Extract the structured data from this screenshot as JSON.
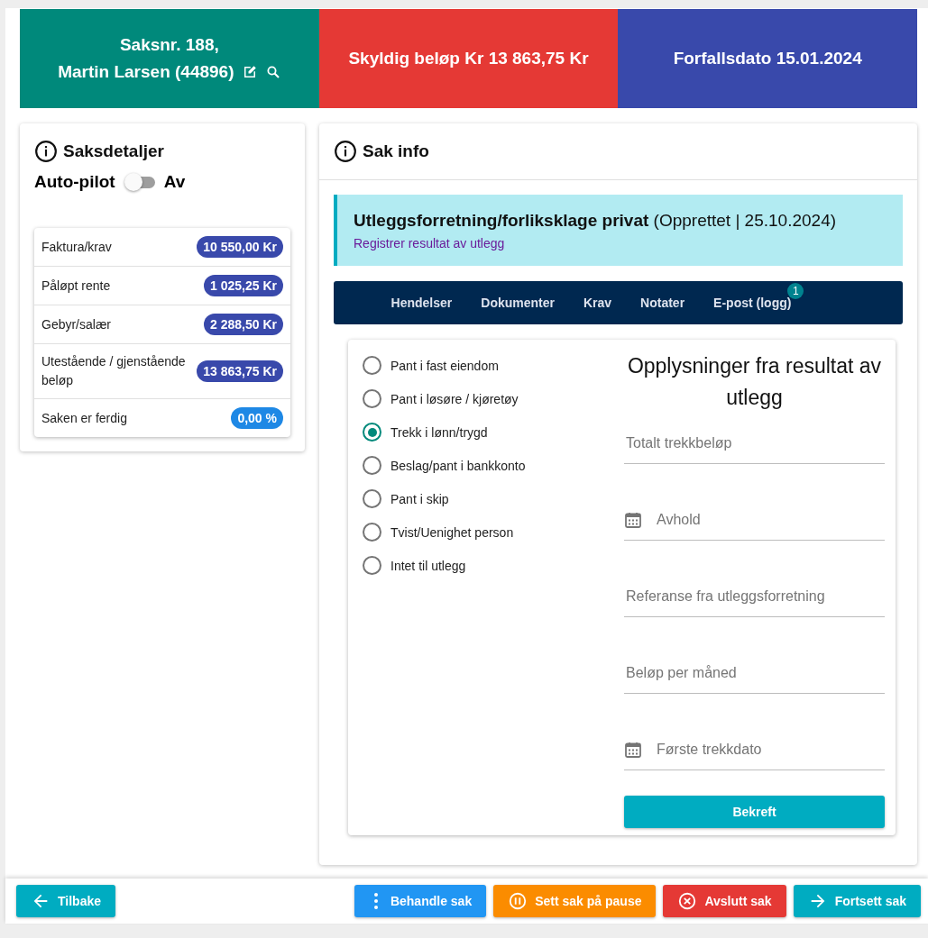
{
  "header": [
    {
      "kind": "case",
      "lines": [
        "Saksnr. 188,",
        "Martin Larsen (44896)"
      ],
      "color": "#00897b"
    },
    {
      "kind": "plain",
      "lines": [
        "Skyldig beløp Kr 13 863,75 Kr"
      ],
      "color": "#e53935"
    },
    {
      "kind": "plain",
      "lines": [
        "Forfallsdato  15.01.2024"
      ],
      "color": "#3949ab"
    }
  ],
  "details": {
    "title": "Saksdetaljer",
    "autopilot": {
      "label": "Auto-pilot",
      "on": false,
      "state_text": "Av"
    },
    "rows": [
      {
        "label": "Faktura/krav",
        "value": "10 550,00 Kr",
        "color": "#3949ab"
      },
      {
        "label": "Påløpt rente",
        "value": "1 025,25 Kr",
        "color": "#3949ab"
      },
      {
        "label": "Gebyr/salær",
        "value": "2 288,50 Kr",
        "color": "#3949ab"
      },
      {
        "label": "Utestående / gjenstående beløp",
        "value": "13 863,75 Kr",
        "color": "#3949ab"
      },
      {
        "label": "Saken er ferdig",
        "value": "0,00 %",
        "color": "#1e88e5"
      }
    ]
  },
  "info": {
    "title": "Sak info",
    "banner": {
      "title": "**Utleggsforretning/forliksklage privat** (Opprettet | 25.10.2024)",
      "link": "Registrer resultat av utlegg"
    },
    "tabs": [
      {
        "label": "Hendelser"
      },
      {
        "label": "Dokumenter"
      },
      {
        "label": "Krav"
      },
      {
        "label": "Notater"
      },
      {
        "label": "E-post (logg)",
        "badge": "1"
      }
    ],
    "options": [
      {
        "label": "Pant i fast eiendom",
        "selected": false
      },
      {
        "label": "Pant i løsøre / kjøretøy",
        "selected": false
      },
      {
        "label": "Trekk i lønn/trygd",
        "selected": true
      },
      {
        "label": "Beslag/pant i bankkonto",
        "selected": false
      },
      {
        "label": "Pant i skip",
        "selected": false
      },
      {
        "label": "Tvist/Uenighet person",
        "selected": false
      },
      {
        "label": "Intet til utlegg",
        "selected": false
      }
    ],
    "form_title": "Opplysninger fra resultat av utlegg",
    "fields": [
      {
        "kind": "text",
        "placeholder": "Totalt trekkbeløp"
      },
      {
        "kind": "date",
        "placeholder": "Avhold"
      },
      {
        "kind": "text",
        "placeholder": "Referanse fra utleggsforretning"
      },
      {
        "kind": "text",
        "placeholder": "Beløp per måned"
      },
      {
        "kind": "date",
        "placeholder": "Første trekkdato"
      }
    ],
    "submit": "Bekreft"
  },
  "footer": {
    "left": [
      {
        "label": "Tilbake",
        "kind": "back",
        "color": "#00acc1"
      }
    ],
    "right": [
      {
        "label": "Behandle sak",
        "kind": "dots",
        "color": "#2196f3"
      },
      {
        "label": "Sett sak på pause",
        "kind": "pause",
        "color": "#fb8c00"
      },
      {
        "label": "Avslutt sak",
        "kind": "cancel",
        "color": "#e53935"
      },
      {
        "label": "Fortsett sak",
        "kind": "forward",
        "color": "#00acc1"
      }
    ]
  }
}
